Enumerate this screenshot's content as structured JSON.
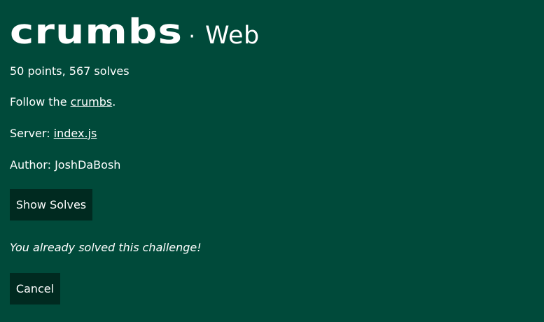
{
  "challenge": {
    "name": "crumbs",
    "separator": "·",
    "category": "Web",
    "points_solves": "50 points, 567 solves",
    "description_prefix": "Follow the ",
    "description_link": "crumbs",
    "description_suffix": ".",
    "server_label": "Server: ",
    "server_link": "index.js",
    "author": "Author: JoshDaBosh"
  },
  "buttons": {
    "show_solves": "Show Solves",
    "cancel": "Cancel"
  },
  "status": {
    "solved_message": "You already solved this challenge!"
  },
  "colors": {
    "background": "#004a3a",
    "button_background": "#002a20",
    "text": "#ffffff"
  }
}
